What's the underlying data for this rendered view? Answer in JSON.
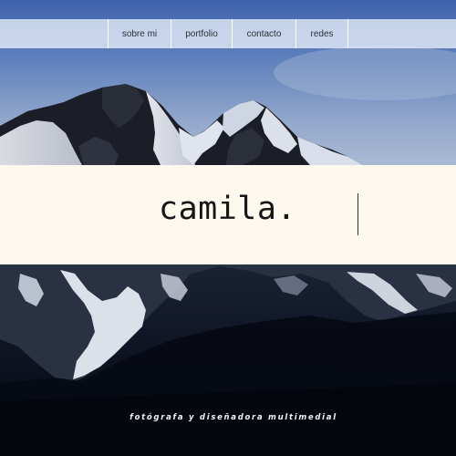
{
  "nav": {
    "items": [
      {
        "label": "sobre mi"
      },
      {
        "label": "portfolio"
      },
      {
        "label": "contacto"
      },
      {
        "label": "redes"
      }
    ]
  },
  "hero": {
    "name": "camila.",
    "tagline": "fotógrafa y diseñadora multimedial"
  },
  "colors": {
    "nav_background": "#e2eaf8",
    "name_band": "#fdf9ee",
    "sky": "#5677b3",
    "mountain_dark": "#0c1220"
  }
}
